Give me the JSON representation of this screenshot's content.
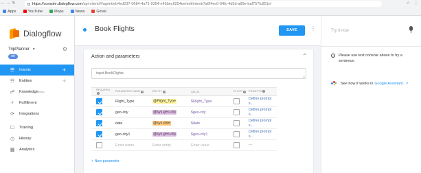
{
  "browser": {
    "url_host": "https://console.dialogflow.com",
    "url_path": "/api-client/#/agent/eb4ed237-0684-4a71-9354-e45bec6254ee/editIntent/7a6f4ec0-94fc-4d5d-a89e-baf757fc851e/",
    "back_icon": "arrow-left-icon",
    "forward_icon": "arrow-right-icon",
    "reload_icon": "reload-icon",
    "bookmarks": [
      {
        "label": "Apps",
        "icon": "apps-grid-icon",
        "color": "#4285f4"
      },
      {
        "label": "YouTube",
        "icon": "youtube-icon",
        "color": "#ff0000"
      },
      {
        "label": "Maps",
        "icon": "maps-icon",
        "color": "#34a853"
      },
      {
        "label": "News",
        "icon": "news-icon",
        "color": "#4285f4"
      },
      {
        "label": "Gmail",
        "icon": "gmail-icon",
        "color": "#ea4335"
      }
    ]
  },
  "sidebar": {
    "logo_text": "Dialogflow",
    "agent_name": "TripPlanner",
    "language": "en",
    "nav": [
      {
        "label": "Intents",
        "icon": "chat-bubble-icon",
        "active": true,
        "plus": true
      },
      {
        "label": "Entities",
        "icon": "entities-icon",
        "active": false,
        "plus": true
      },
      {
        "label": "Knowledge",
        "icon": "knowledge-icon",
        "active": false,
        "plus": false,
        "badge": "[beta]"
      },
      {
        "label": "Fulfillment",
        "icon": "lightning-icon",
        "active": false,
        "plus": false
      },
      {
        "label": "Integrations",
        "icon": "integrations-icon",
        "active": false,
        "plus": false
      },
      {
        "label": "Training",
        "icon": "training-icon",
        "active": false,
        "plus": false
      },
      {
        "label": "History",
        "icon": "history-icon",
        "active": false,
        "plus": false
      },
      {
        "label": "Analytics",
        "icon": "analytics-icon",
        "active": false,
        "plus": false
      }
    ]
  },
  "header": {
    "intent_title": "Book Flights",
    "save_label": "SAVE"
  },
  "section": {
    "title": "Action and parameters",
    "action_input": "input.BookFlights",
    "columns": [
      "REQUIRED",
      "PARAMETER NAME",
      "ENTITY",
      "VALUE",
      "IS LIST",
      "PROMPTS"
    ],
    "rows": [
      {
        "required": true,
        "name": "Flight_Type",
        "entity": "@Flight_Type",
        "entity_color": "#fff59d",
        "value": "$Flight_Type",
        "is_list": false,
        "prompt1": "Define prompt",
        "prompt2": "s..."
      },
      {
        "required": true,
        "name": "geo-city",
        "entity": "@sys.geo-city",
        "entity_color": "#e1bee7",
        "value": "$geo-city",
        "is_list": false,
        "prompt1": "Define prompt",
        "prompt2": "s..."
      },
      {
        "required": true,
        "name": "date",
        "entity": "@sys.date",
        "entity_color": "#ffcc80",
        "value": "$date",
        "is_list": false,
        "prompt1": "Define prompt",
        "prompt2": "s..."
      },
      {
        "required": true,
        "name": "geo-city1",
        "entity": "@sys.geo-city",
        "entity_color": "#e1bee7",
        "value": "$geo-city1",
        "is_list": false,
        "prompt1": "Define prompt",
        "prompt2": "s..."
      }
    ],
    "empty_row": {
      "name_placeholder": "Enter name",
      "entity_placeholder": "Enter entity",
      "value_placeholder": "Enter value",
      "prompt": "—"
    },
    "new_parameter": "+ New parameter"
  },
  "try_panel": {
    "placeholder": "Try it now",
    "info_text": "Please use test console above to try a sentence.",
    "assistant_prefix": "See how it works in",
    "assistant_link": "Google Assistant."
  }
}
